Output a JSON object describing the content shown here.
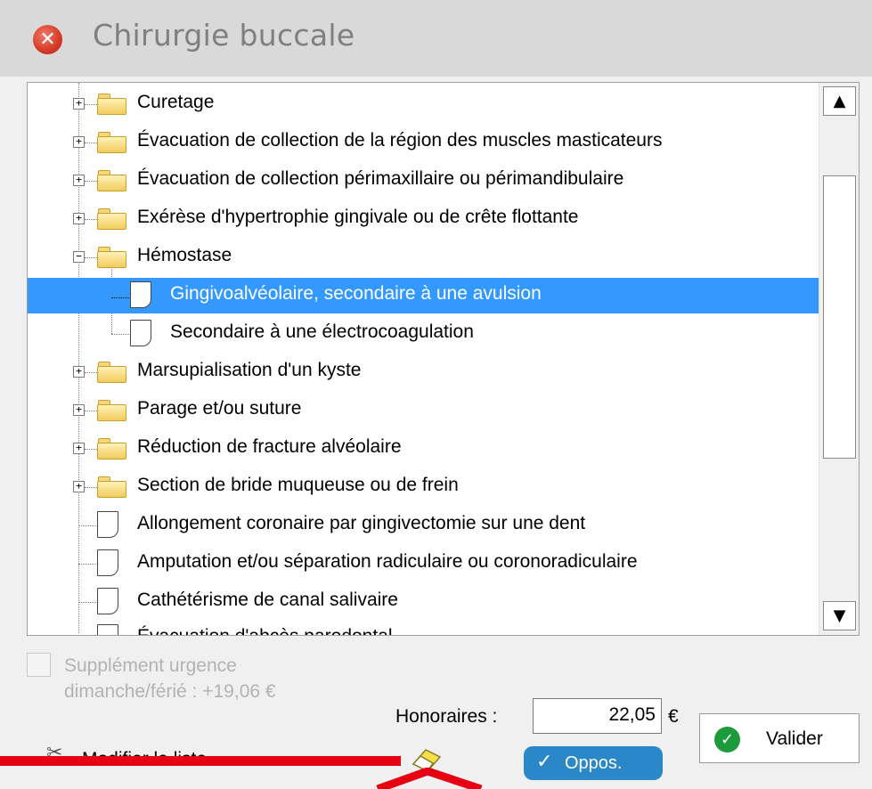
{
  "window": {
    "title": "Chirurgie buccale"
  },
  "tree": {
    "items": [
      {
        "label": "Curetage",
        "type": "folder",
        "state": "collapsed"
      },
      {
        "label": "Évacuation de collection de la région des muscles masticateurs",
        "type": "folder",
        "state": "collapsed"
      },
      {
        "label": "Évacuation de collection périmaxillaire ou périmandibulaire",
        "type": "folder",
        "state": "collapsed"
      },
      {
        "label": "Exérèse d'hypertrophie gingivale ou de crête flottante",
        "type": "folder",
        "state": "collapsed"
      },
      {
        "label": "Hémostase",
        "type": "folder",
        "state": "expanded"
      },
      {
        "label": "Gingivoalvéolaire, secondaire à une avulsion",
        "type": "document",
        "selected": true
      },
      {
        "label": "Secondaire à une électrocoagulation",
        "type": "document"
      },
      {
        "label": "Marsupialisation d'un kyste",
        "type": "folder",
        "state": "collapsed"
      },
      {
        "label": "Parage et/ou suture",
        "type": "folder",
        "state": "collapsed"
      },
      {
        "label": "Réduction de fracture alvéolaire",
        "type": "folder",
        "state": "collapsed"
      },
      {
        "label": "Section de bride muqueuse ou de frein",
        "type": "folder",
        "state": "collapsed"
      },
      {
        "label": "Allongement coronaire par gingivectomie sur une dent",
        "type": "document"
      },
      {
        "label": "Amputation et/ou séparation radiculaire ou coronoradiculaire",
        "type": "document"
      },
      {
        "label": "Cathétérisme de canal salivaire",
        "type": "document"
      },
      {
        "label": "Évacuation d'abcès parodontal",
        "type": "document"
      }
    ]
  },
  "urgence": {
    "label": "Supplément urgence dimanche/férié : +19,06 €",
    "checked": false
  },
  "honoraires": {
    "label": "Honoraires :",
    "value": "22,05",
    "currency": "€"
  },
  "buttons": {
    "valider": "Valider",
    "oppos": "Oppos.",
    "modifier": "Modifier la liste"
  },
  "colors": {
    "selection": "#3399ff",
    "annotation": "#e60012",
    "oppos": "#2a88c8",
    "valider_icon": "#1d9b3a"
  }
}
